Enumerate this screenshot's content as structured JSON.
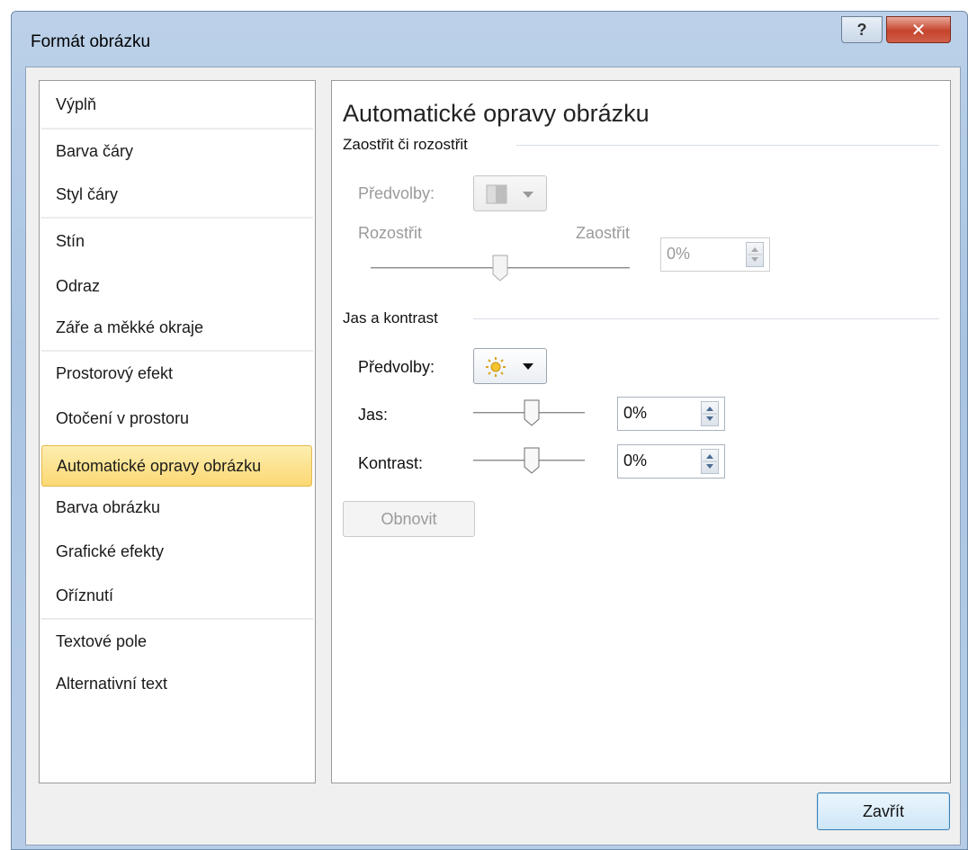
{
  "window": {
    "title": "Formát obrázku",
    "help_icon": "help-icon",
    "close_icon": "close-icon"
  },
  "sidebar": {
    "items": [
      {
        "label": "Výplň"
      },
      {
        "label": "Barva čáry"
      },
      {
        "label": "Styl čáry"
      },
      {
        "label": "Stín"
      },
      {
        "label": "Odraz"
      },
      {
        "label": "Záře a měkké okraje"
      },
      {
        "label": "Prostorový efekt"
      },
      {
        "label": "Otočení v prostoru"
      },
      {
        "label": "Automatické opravy obrázku",
        "selected": true
      },
      {
        "label": "Barva obrázku"
      },
      {
        "label": "Grafické efekty"
      },
      {
        "label": "Oříznutí"
      },
      {
        "label": "Textové pole"
      },
      {
        "label": "Alternativní text"
      }
    ],
    "selected_color": "#fbd873"
  },
  "panel": {
    "title": "Automatické opravy obrázku",
    "sharpen": {
      "heading": "Zaostřit či rozostřit",
      "presets_label": "Předvolby:",
      "blur_label": "Rozostřit",
      "sharpen_label": "Zaostřit",
      "value": "0%",
      "enabled": false
    },
    "brightness": {
      "heading": "Jas a kontrast",
      "presets_label": "Předvolby:",
      "jas_label": "Jas:",
      "jas_value": "0%",
      "contrast_label": "Kontrast:",
      "contrast_value": "0%"
    },
    "reset_label": "Obnovit"
  },
  "footer": {
    "close_label": "Zavřít"
  }
}
